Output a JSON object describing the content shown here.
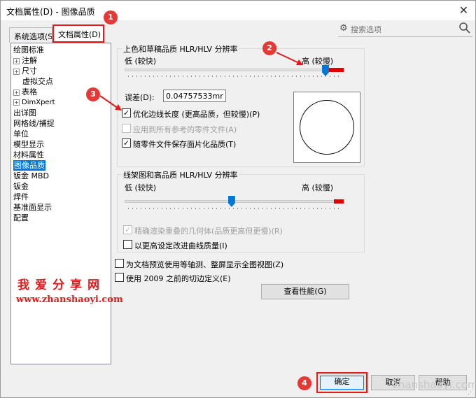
{
  "window": {
    "title": "文档属性(D) - 图像品质",
    "close_symbol": "✕"
  },
  "tabs": [
    {
      "label": "系统选项(S"
    },
    {
      "label": "文档属性(D)"
    }
  ],
  "search": {
    "placeholder": "搜索选项"
  },
  "tree": {
    "items": [
      {
        "label": "绘图标准"
      },
      {
        "label": "注解",
        "expandable": true
      },
      {
        "label": "尺寸",
        "expandable": true
      },
      {
        "label": "虚拟交点"
      },
      {
        "label": "表格",
        "expandable": true
      },
      {
        "label": "DimXpert",
        "expandable": true
      },
      {
        "label": "出详图"
      },
      {
        "label": "网格线/捕捉"
      },
      {
        "label": "单位"
      },
      {
        "label": "模型显示"
      },
      {
        "label": "材料属性"
      },
      {
        "label": "图像品质",
        "selected": true
      },
      {
        "label": "钣金 MBD"
      },
      {
        "label": "钣金"
      },
      {
        "label": "焊件"
      },
      {
        "label": "基准面显示"
      },
      {
        "label": "配置"
      }
    ]
  },
  "shaded_group": {
    "title": "上色和草稿品质 HLR/HLV 分辨率",
    "low_label": "低 (较快)",
    "high_label": "高 (较慢)",
    "slider_value_pct": 92,
    "deviation_label": "误差(D):",
    "deviation_value": "0.04757533mm",
    "optimize_label": "优化边线长度 (更高品质，但较慢)(P)",
    "optimize_checked": true,
    "apply_all_label": "应用到所有参考的零件文件(A)",
    "apply_all_checked": false,
    "save_tess_label": "随零件文件保存面片化品质(T)",
    "save_tess_checked": true
  },
  "wire_group": {
    "title": "线架图和高品质 HLR/HLV 分辨率",
    "low_label": "低 (较快)",
    "high_label": "高 (较慢)",
    "slider_value_pct": 49,
    "precise_label": "精确渲染重叠的几何体(品质更高但更慢)(R)",
    "precise_checked": true,
    "improve_label": "以更高设定改进曲线质量(I)",
    "improve_checked": false
  },
  "isometric_label": "为文档预览使用等轴测、整屏显示全图视图(Z)",
  "isometric_checked": false,
  "pre2009_label": "使用 2009 之前的切边定义(E)",
  "pre2009_checked": false,
  "perf_button": "查看性能(G)",
  "buttons": {
    "ok": "确定",
    "cancel": "取消",
    "help": "帮助"
  },
  "annotations": {
    "b1": "1",
    "b2": "2",
    "b3": "3",
    "b4": "4"
  },
  "watermark": {
    "cn": "我爱分享网",
    "url": "www.zhanshaoyi.com",
    "url2": "zhanshaoyi.com"
  },
  "colors": {
    "accent": "#0078d7",
    "annotation_red": "#e11b1b"
  }
}
